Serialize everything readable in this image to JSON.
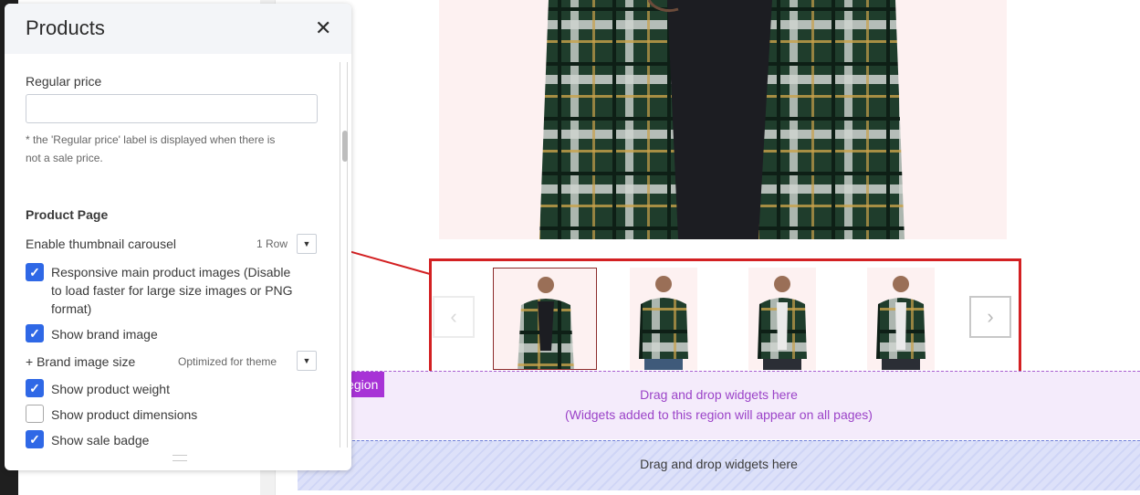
{
  "panel": {
    "title": "Products",
    "close_icon": "close-icon",
    "regular_price_label": "Regular price",
    "regular_price_value": "",
    "regular_price_note_line1": "* the 'Regular price' label is displayed when there is",
    "regular_price_note_line2": "not a sale price.",
    "section_title": "Product Page",
    "thumbnail_carousel_label": "Enable thumbnail carousel",
    "thumbnail_carousel_value": "1 Row",
    "brand_image_size_label": "+ Brand image size",
    "brand_image_size_value": "Optimized for theme",
    "options": [
      {
        "label_lines": [
          "Responsive main product images (Disable",
          "to load faster for large size images or PNG",
          "format)"
        ],
        "checked": true
      },
      {
        "label_lines": [
          "Show brand image"
        ],
        "checked": true
      },
      {
        "label_lines": [
          "Show product weight"
        ],
        "checked": true
      },
      {
        "label_lines": [
          "Show product dimensions"
        ],
        "checked": false
      },
      {
        "label_lines": [
          "Show sale badge"
        ],
        "checked": true
      }
    ]
  },
  "canvas": {
    "region_tag": "Region",
    "region_text_line1": "Drag and drop widgets here",
    "region_text_line2": "(Widgets added to this region will appear on all pages)",
    "blue_region_text": "Drag and drop widgets here",
    "carousel_prev_icon": "chevron-left-icon",
    "carousel_next_icon": "chevron-right-icon",
    "thumbnail_count": 4,
    "selected_thumbnail": 1
  },
  "colors": {
    "accent_blue": "#2f68e6",
    "annotation_red": "#d32022",
    "region_purple": "#a733d6"
  }
}
